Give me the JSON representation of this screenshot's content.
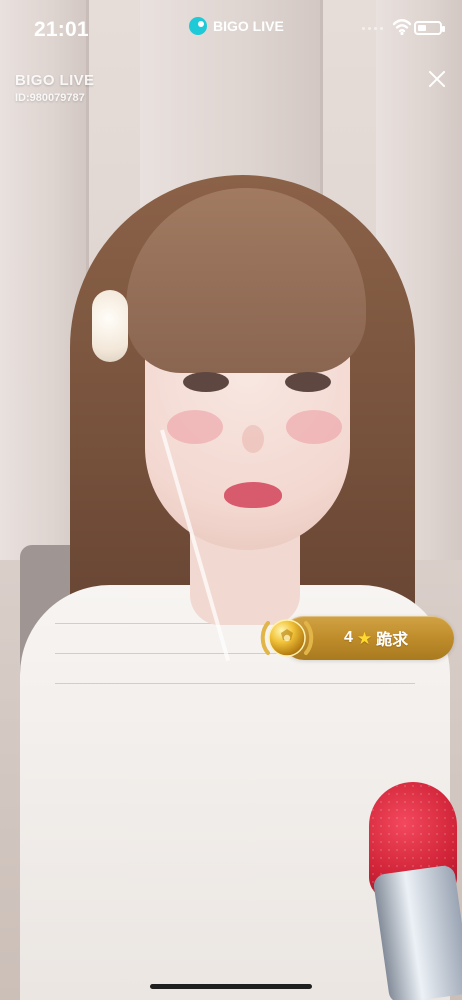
{
  "status_bar": {
    "time": "21:01",
    "app_name": "BIGO LIVE",
    "battery_percent": 35
  },
  "watermark": {
    "brand": "BIGO LIVE",
    "id": "ID:980079787"
  },
  "gift": {
    "count": "4",
    "label": "跪求"
  },
  "icons": {
    "app": "bigo-live-logo-icon",
    "wifi": "wifi-icon",
    "battery": "battery-icon",
    "close": "close-icon",
    "medal": "soccer-medal-icon",
    "star": "star-icon"
  },
  "colors": {
    "gift_pill": "#c08d2b",
    "star": "#ffd92d",
    "app_logo": "#1ec9d8"
  }
}
